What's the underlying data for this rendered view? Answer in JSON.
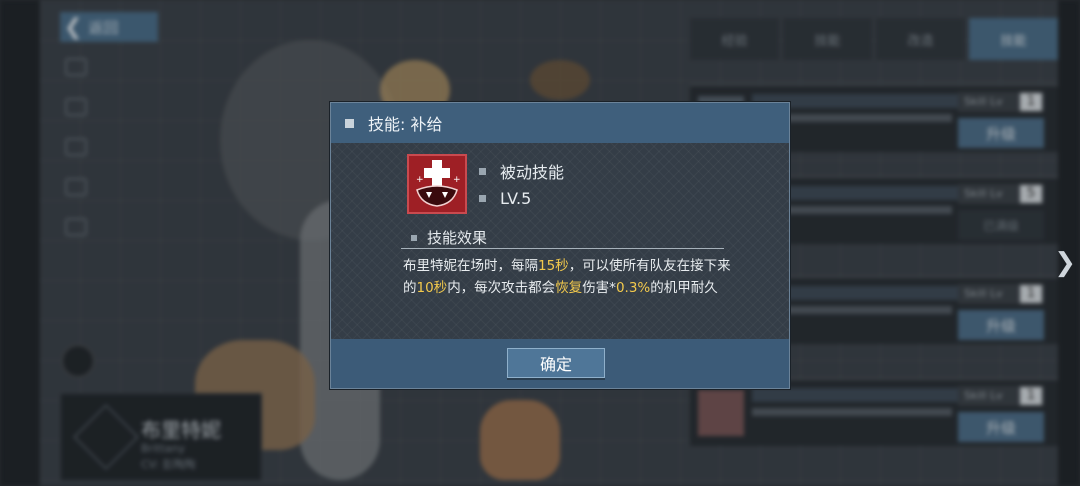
{
  "background": {
    "back_label": "返回",
    "tabs": [
      "经验",
      "技能",
      "改造",
      "技能"
    ],
    "character_name": "布里特妮",
    "character_name_en": "Brittany",
    "character_cv": "CV: 彭陶陶",
    "skill_level_label": "Skill Lv",
    "skill_rows": [
      {
        "level": "1",
        "upgrade": "升级"
      },
      {
        "level": "5",
        "upgrade": "已满级"
      },
      {
        "level": "1",
        "upgrade": "升级"
      },
      {
        "level": "1",
        "upgrade": "升级"
      }
    ]
  },
  "dialog": {
    "title": "技能: 补给",
    "skill_type": "被动技能",
    "level": "LV.5",
    "effect_heading": "技能效果",
    "effect": {
      "p1": "布里特妮在场时，每隔",
      "h1": "15秒",
      "p2": "，可以使所有队友在接下来的",
      "h2": "10秒",
      "p3": "内，每次攻击都会",
      "h3": "恢复",
      "p4": "伤害*",
      "h4": "0.3%",
      "p5": "的机甲耐久"
    },
    "confirm_label": "确定"
  },
  "colors": {
    "header": "#3f5f7c",
    "body": "#343d47",
    "highlight": "#f2c94c",
    "icon_red": "#a52228"
  }
}
